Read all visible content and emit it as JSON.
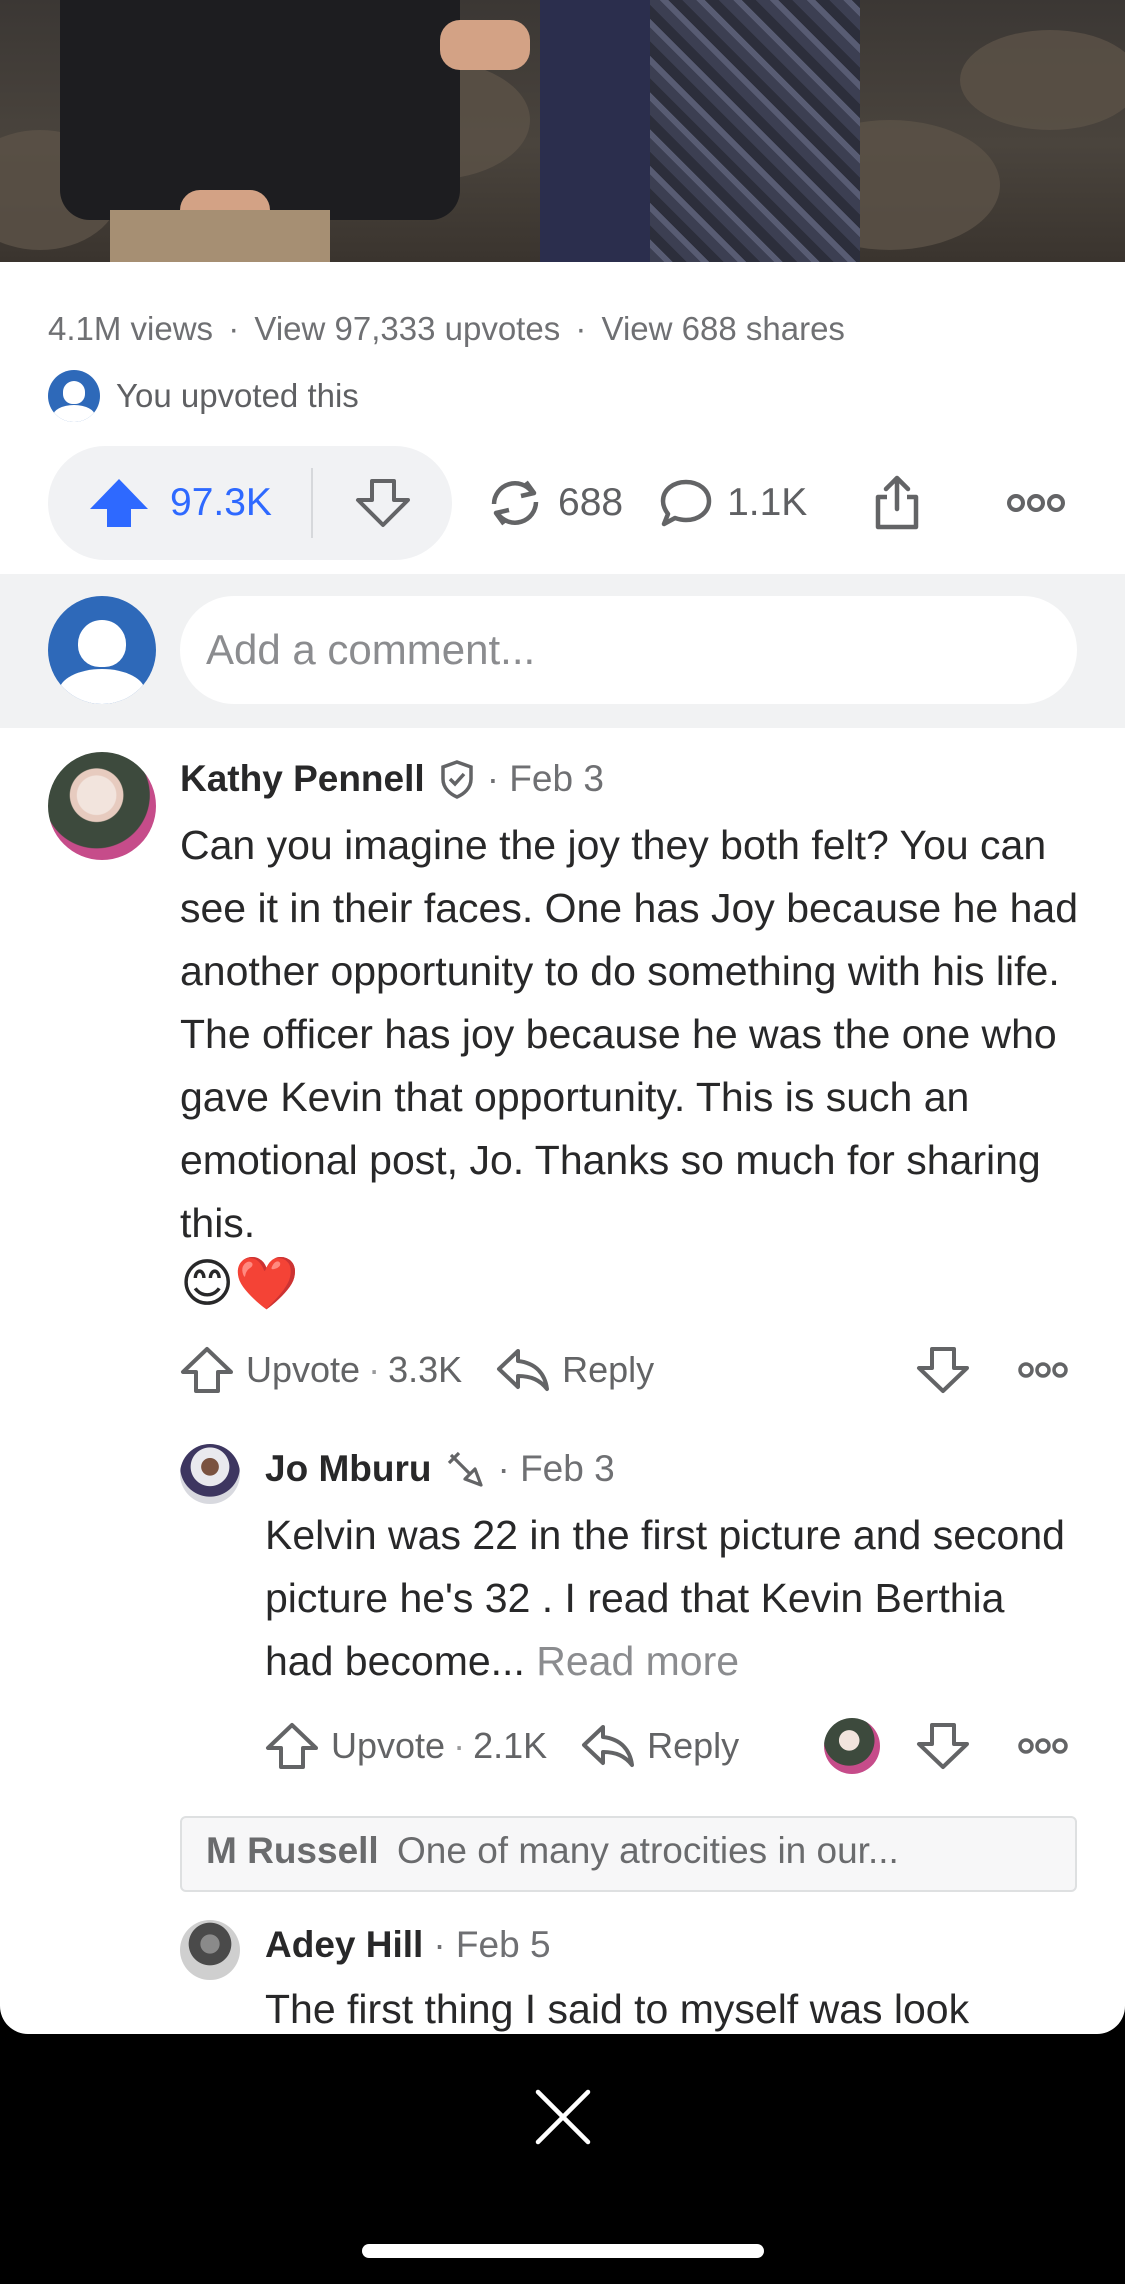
{
  "post": {
    "stats": {
      "views": "4.1M views",
      "upvotes_link": "View 97,333 upvotes",
      "shares_link": "View 688 shares",
      "separator": "·"
    },
    "upvoted_note": "You upvoted this",
    "actions": {
      "upvote_count": "97.3K",
      "share_count": "688",
      "comment_count": "1.1K"
    }
  },
  "comment_input": {
    "placeholder": "Add a comment..."
  },
  "comments": [
    {
      "author": "Kathy Pennell",
      "date": "· Feb 3",
      "text": "Can you imagine the joy they both felt? You can see it in their faces. One has Joy because he had another opportunity to do something with his life. The officer has joy because he was the one who gave Kevin that opportunity. This is such an emotional post, Jo. Thanks so much for sharing this.",
      "emojis": "😊❤️",
      "upvote_label": "Upvote",
      "upvote_count": "3.3K",
      "reply_label": "Reply"
    },
    {
      "author": "Jo Mburu",
      "date": "· Feb 3",
      "text": "Kelvin was 22 in the first picture and second picture he's 32 . I read that Kevin Berthia had become...",
      "read_more": "Read more",
      "upvote_label": "Upvote",
      "upvote_count": "2.1K",
      "reply_label": "Reply"
    },
    {
      "quote_author": "M Russell",
      "quote_text": "One of many atrocities in our..."
    },
    {
      "author": "Adey Hill",
      "date": "· Feb 5",
      "text": "The first thing I said to myself was look"
    }
  ],
  "colors": {
    "accent": "#2e69ff",
    "brand_avatar": "#2e69b9"
  }
}
